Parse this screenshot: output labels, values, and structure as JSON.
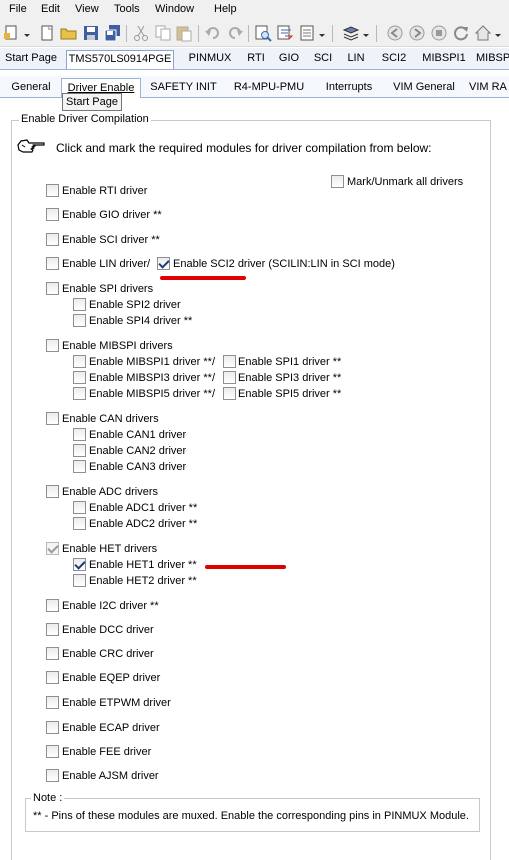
{
  "menu": [
    "File",
    "Edit",
    "View",
    "Tools",
    "Window",
    "Help"
  ],
  "top_tabs": [
    "Start Page",
    "TMS570LS0914PGE",
    "PINMUX",
    "RTI",
    "GIO",
    "SCI",
    "LIN",
    "SCI2",
    "MIBSPI1",
    "MIBSP"
  ],
  "sub_tabs": [
    "General",
    "Driver Enable",
    "SAFETY INIT",
    "R4-MPU-PMU",
    "Interrupts",
    "VIM General",
    "VIM RA"
  ],
  "tooltip": "Start Page",
  "group_title": "Enable Driver Compilation",
  "instruction": "Click and mark the required modules for driver compilation from below:",
  "mark_all": {
    "label": "Mark/Unmark all drivers",
    "checked": false
  },
  "items": {
    "rti": {
      "label": "Enable RTI driver",
      "checked": false
    },
    "gio": {
      "label": "Enable GIO driver **",
      "checked": false
    },
    "sci": {
      "label": "Enable SCI driver **",
      "checked": false
    },
    "lin": {
      "label": "Enable LIN driver",
      "checked": false
    },
    "lin_sep": "/",
    "sci2": {
      "label": "Enable SCI2 driver (SCILIN:LIN in SCI mode)",
      "checked": true
    },
    "spi": {
      "label": "Enable SPI drivers",
      "checked": false
    },
    "spi2": {
      "label": "Enable SPI2 driver",
      "checked": false
    },
    "spi4": {
      "label": "Enable SPI4 driver **",
      "checked": false
    },
    "mibspi": {
      "label": "Enable MIBSPI drivers",
      "checked": false
    },
    "mibspi1": {
      "label": "Enable MIBSPI1 driver **",
      "checked": false
    },
    "spi1": {
      "label": "Enable SPI1 driver **",
      "checked": false
    },
    "mibspi3": {
      "label": "Enable MIBSPI3 driver **",
      "checked": false
    },
    "spi3": {
      "label": "Enable SPI3 driver **",
      "checked": false
    },
    "mibspi5": {
      "label": "Enable MIBSPI5 driver **",
      "checked": false
    },
    "spi5": {
      "label": "Enable SPI5 driver **",
      "checked": false
    },
    "slash": "/",
    "can": {
      "label": "Enable CAN drivers",
      "checked": false
    },
    "can1": {
      "label": "Enable CAN1 driver",
      "checked": false
    },
    "can2": {
      "label": "Enable CAN2 driver",
      "checked": false
    },
    "can3": {
      "label": "Enable CAN3 driver",
      "checked": false
    },
    "adc": {
      "label": "Enable ADC drivers",
      "checked": false
    },
    "adc1": {
      "label": "Enable ADC1 driver **",
      "checked": false
    },
    "adc2": {
      "label": "Enable ADC2 driver **",
      "checked": false
    },
    "het": {
      "label": "Enable HET drivers",
      "checked": true
    },
    "het1": {
      "label": "Enable HET1 driver **",
      "checked": true
    },
    "het2": {
      "label": "Enable HET2 driver **",
      "checked": false
    },
    "i2c": {
      "label": "Enable I2C driver **",
      "checked": false
    },
    "dcc": {
      "label": "Enable DCC driver",
      "checked": false
    },
    "crc": {
      "label": "Enable CRC driver",
      "checked": false
    },
    "eqep": {
      "label": "Enable EQEP driver",
      "checked": false
    },
    "etpwm": {
      "label": "Enable ETPWM driver",
      "checked": false
    },
    "ecap": {
      "label": "Enable ECAP driver",
      "checked": false
    },
    "fee": {
      "label": "Enable FEE driver",
      "checked": false
    },
    "ajsm": {
      "label": "Enable AJSM driver",
      "checked": false
    }
  },
  "note_title": "Note :",
  "note_text": "** - Pins of these modules are muxed. Enable the corresponding pins in PINMUX Module.",
  "colors": {
    "tab_bar": "#eef3fa",
    "tab_border": "#9db3d4",
    "annotation_red": "#e00000"
  },
  "icons": [
    "pointing-hand-icon",
    "new-file-icon",
    "open-folder-icon",
    "save-icon",
    "save-all-icon",
    "cut-icon",
    "copy-icon",
    "paste-icon",
    "undo-icon",
    "redo-icon",
    "find-icon",
    "replace-icon",
    "properties-icon",
    "layers-icon",
    "nav-back-icon",
    "nav-forward-icon",
    "refresh-icon",
    "home-icon",
    "home-dropdown-icon"
  ]
}
